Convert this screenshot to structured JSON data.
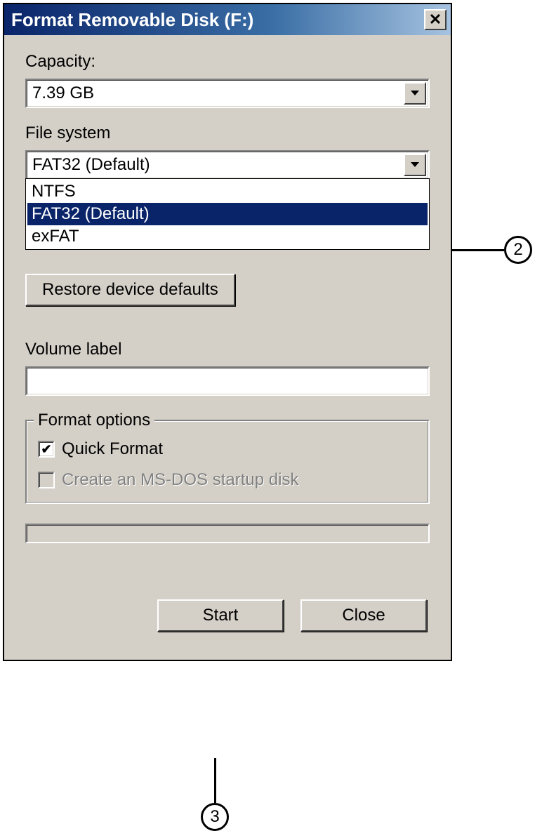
{
  "titlebar": {
    "title": "Format Removable Disk (F:)",
    "close_symbol": "✕"
  },
  "capacity": {
    "label": "Capacity:",
    "value": "7.39 GB"
  },
  "filesystem": {
    "label": "File system",
    "value": "FAT32 (Default)",
    "options": [
      {
        "label": "NTFS",
        "selected": false
      },
      {
        "label": "FAT32 (Default)",
        "selected": true
      },
      {
        "label": "exFAT",
        "selected": false
      }
    ]
  },
  "restore": {
    "label": "Restore device defaults"
  },
  "volume": {
    "label": "Volume label",
    "value": ""
  },
  "format_options": {
    "legend": "Format options",
    "quick_format": {
      "label": "Quick Format",
      "checked": true
    },
    "msdos": {
      "label": "Create an MS-DOS startup disk",
      "checked": false,
      "disabled": true
    }
  },
  "buttons": {
    "start": "Start",
    "close": "Close"
  },
  "callouts": {
    "two": "2",
    "three": "3"
  }
}
